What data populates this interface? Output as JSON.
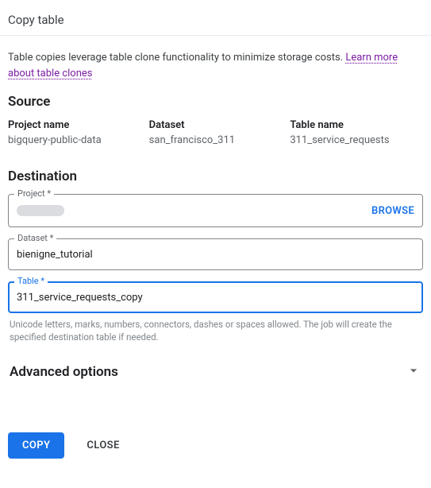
{
  "dialog": {
    "title": "Copy table",
    "info_text": "Table copies leverage table clone functionality to minimize storage costs. ",
    "info_link": "Learn more about table clones"
  },
  "source": {
    "heading": "Source",
    "project_label": "Project name",
    "project_value": "bigquery-public-data",
    "dataset_label": "Dataset",
    "dataset_value": "san_francisco_311",
    "table_label": "Table name",
    "table_value": "311_service_requests"
  },
  "destination": {
    "heading": "Destination",
    "project": {
      "label": "Project *",
      "browse": "BROWSE"
    },
    "dataset": {
      "label": "Dataset *",
      "value": "bienigne_tutorial"
    },
    "table": {
      "label": "Table *",
      "value": "311_service_requests_copy",
      "helper": "Unicode letters, marks, numbers, connectors, dashes or spaces allowed. The job will create the specified destination table if needed."
    }
  },
  "advanced": {
    "label": "Advanced options"
  },
  "actions": {
    "copy": "COPY",
    "close": "CLOSE"
  }
}
